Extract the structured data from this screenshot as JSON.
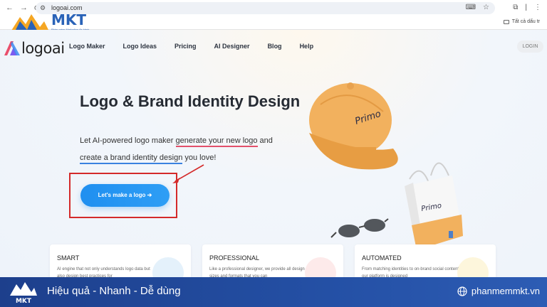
{
  "browser": {
    "url": "logoai.com",
    "bookmark_label": "Tất cả dấu tr"
  },
  "overlay_logo": {
    "name": "MKT",
    "tagline": "Phần mềm Marketing đa kênh"
  },
  "site": {
    "brand": "logoai",
    "menu": [
      "Logo Maker",
      "Logo Ideas",
      "Pricing",
      "AI Designer",
      "Blog",
      "Help"
    ],
    "login_label": "LOGIN"
  },
  "hero": {
    "title": "Logo & Brand Identity Design",
    "desc_part1": "Let AI-powered logo maker ",
    "desc_highlight1": "generate your new logo",
    "desc_part2": " and ",
    "desc_highlight2": "create a brand identity design",
    "desc_part3": " you love!",
    "cta_label": "Let's make a logo ➔"
  },
  "art": {
    "cap_brand": "Primo",
    "bag_brand": "Primo"
  },
  "cards": [
    {
      "title": "SMART",
      "text": "AI engine that not only understands logo data but also design best practices for"
    },
    {
      "title": "PROFESSIONAL",
      "text": "Like a professional designer, we provide all design sizes and formats that you can"
    },
    {
      "title": "AUTOMATED",
      "text": "From matching identities to on-brand social content, our platform is designed"
    }
  ],
  "banner": {
    "slogan": "Hiệu quả - Nhanh  - Dễ dùng",
    "site": "phanmemmkt.vn"
  },
  "colors": {
    "cta": "#1f8ff0",
    "highlight_box": "#d42a2a",
    "banner": "#1d3f8c"
  }
}
